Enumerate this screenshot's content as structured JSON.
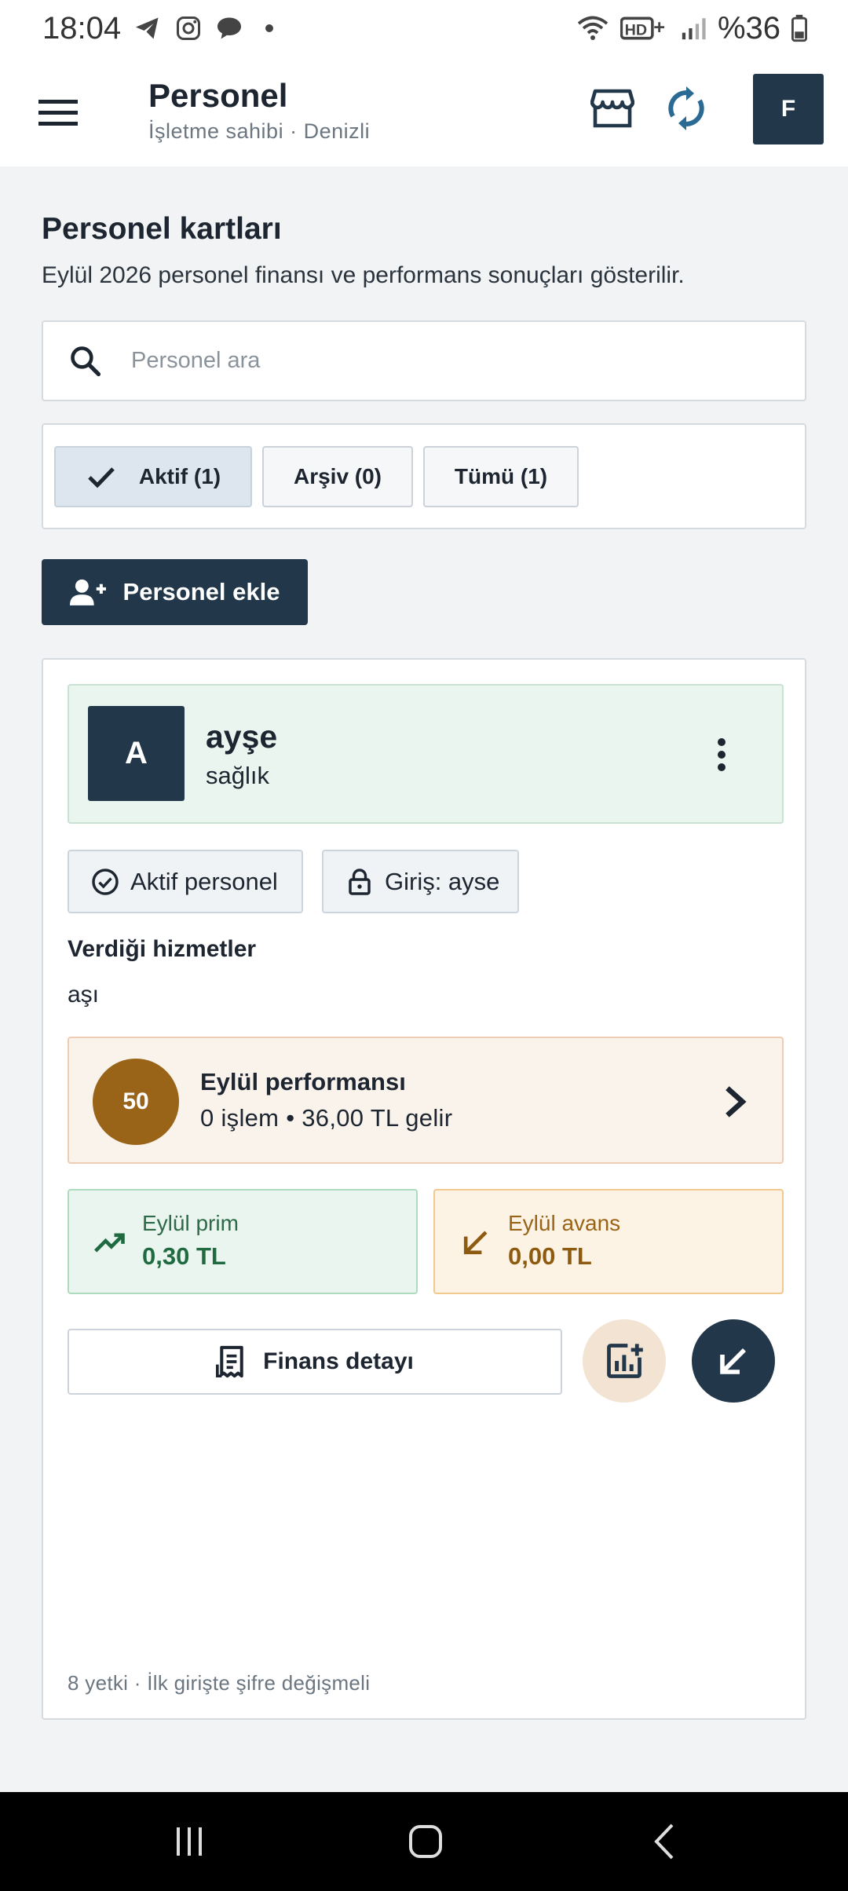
{
  "status_bar": {
    "time": "18:04",
    "battery": "%36",
    "icons": [
      "telegram-icon",
      "instagram-icon",
      "chat-icon",
      "wifi-icon",
      "hd-plus-icon",
      "signal-icon",
      "battery-icon"
    ]
  },
  "app_bar": {
    "title": "Personel",
    "subtitle": "İşletme sahibi · Denizli",
    "profile_initial": "F",
    "icons": [
      "menu-icon",
      "store-icon",
      "sync-icon"
    ]
  },
  "page": {
    "title": "Personel kartları",
    "description": "Eylül 2026 personel finansı ve performans sonuçları gösterilir."
  },
  "search": {
    "placeholder": "Personel ara",
    "value": ""
  },
  "filters": [
    {
      "label": "Aktif (1)",
      "selected": true
    },
    {
      "label": "Arşiv (0)",
      "selected": false
    },
    {
      "label": "Tümü (1)",
      "selected": false
    }
  ],
  "add_button": {
    "label": "Personel ekle"
  },
  "staff_card": {
    "initial": "A",
    "name": "ayşe",
    "role": "sağlık",
    "badges": [
      {
        "label": "Aktif personel",
        "icon": "check-circle-icon"
      },
      {
        "label": "Giriş: ayse",
        "icon": "lock-icon"
      }
    ],
    "services_title": "Verdiği hizmetler",
    "services_value": "aşı",
    "performance": {
      "score": "50",
      "title": "Eylül performansı",
      "summary": "0 işlem • 36,00 TL gelir"
    },
    "prim": {
      "label": "Eylül prim",
      "value": "0,30 TL"
    },
    "avans": {
      "label": "Eylül avans",
      "value": "0,00 TL"
    },
    "finance_button": "Finans detayı",
    "footer": "8 yetki · İlk girişte şifre değişmeli"
  },
  "colors": {
    "primary": "#22384a",
    "success_bg": "#e9f5ee",
    "warning_bg": "#fdf3e4",
    "score": "#9a6418"
  }
}
